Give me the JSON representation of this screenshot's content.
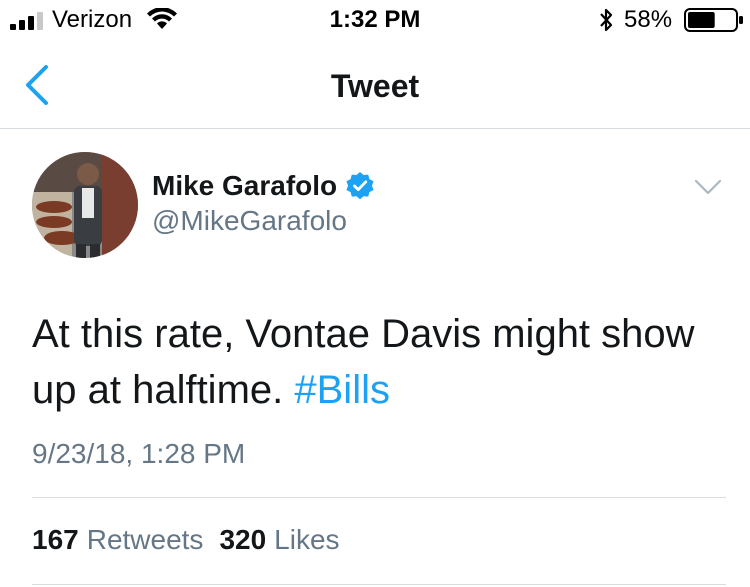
{
  "status_bar": {
    "carrier": "Verizon",
    "time": "1:32 PM",
    "battery_percent": "58%",
    "battery_level": 0.58,
    "icons": [
      "signal-icon",
      "wifi-icon",
      "bluetooth-icon",
      "battery-icon"
    ]
  },
  "nav": {
    "title": "Tweet",
    "back_icon": "chevron-left-icon"
  },
  "tweet": {
    "author_name": "Mike Garafolo",
    "verified": true,
    "handle": "@MikeGarafolo",
    "text": "At this rate, Vontae Davis might show up at halftime. ",
    "hashtag": "#Bills",
    "timestamp": "9/23/18, 1:28 PM",
    "stats": {
      "retweets_count": "167",
      "retweets_label": "Retweets",
      "likes_count": "320",
      "likes_label": "Likes"
    }
  },
  "colors": {
    "accent": "#1da1f2",
    "secondary_text": "#657786",
    "primary_text": "#14171a",
    "divider": "#d8dde1"
  }
}
